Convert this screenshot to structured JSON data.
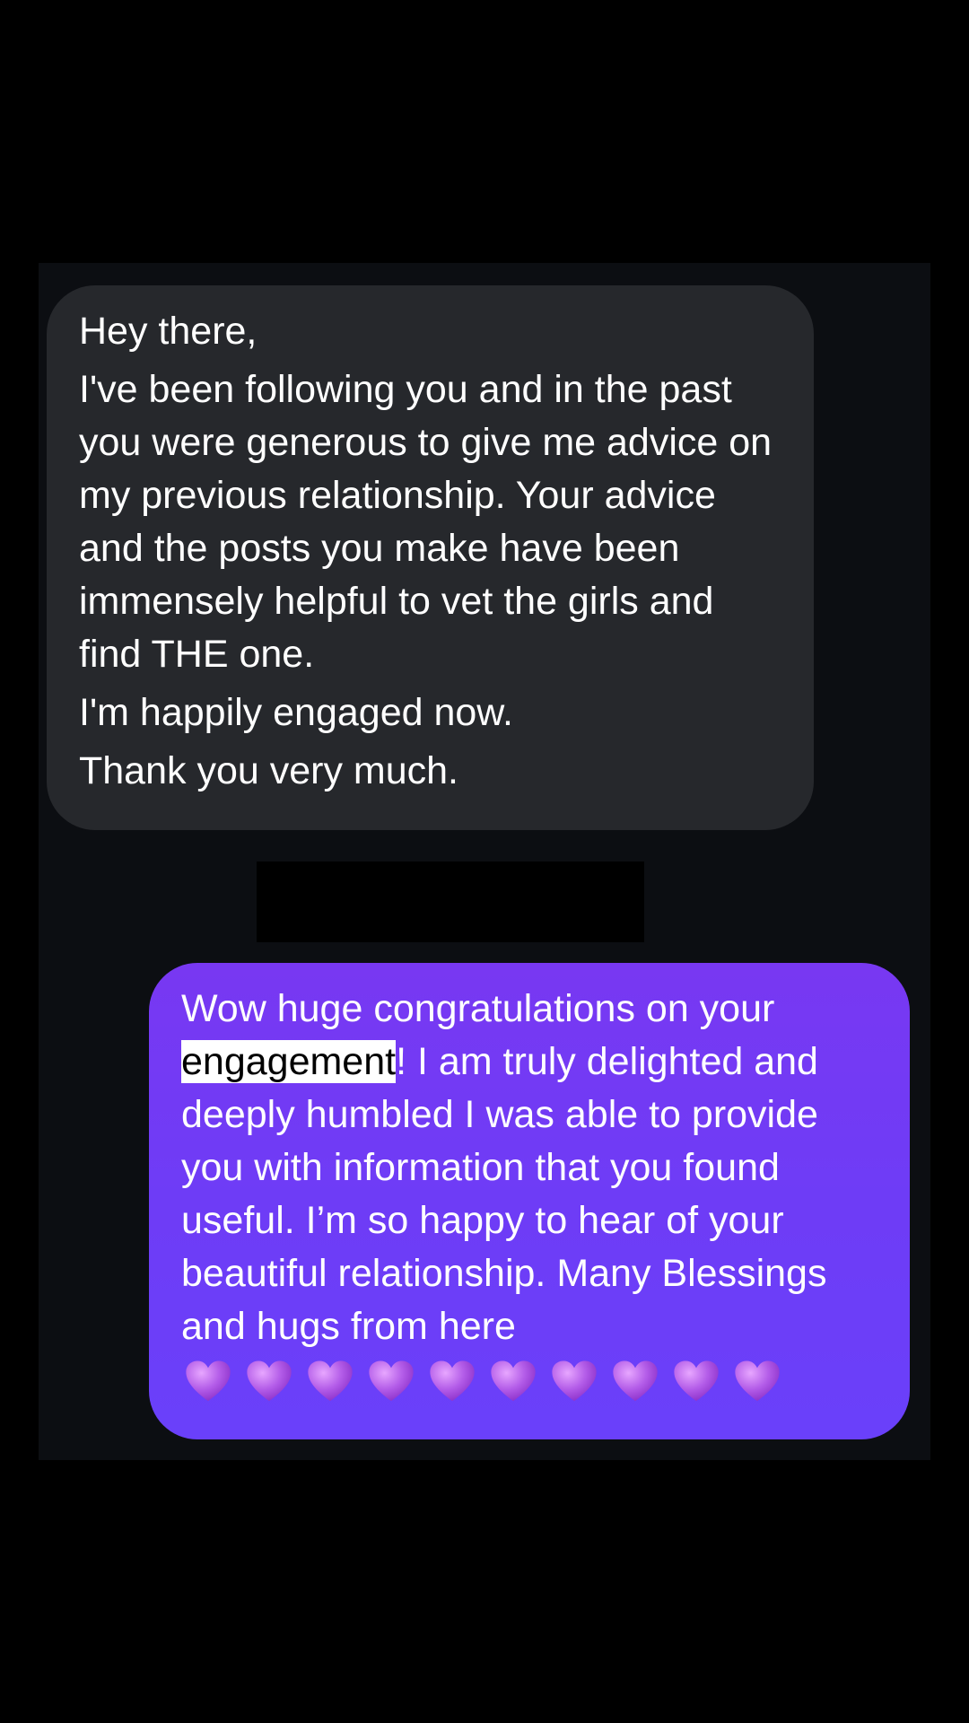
{
  "conversation": {
    "incoming_message": {
      "greeting": "Hey there,",
      "body": "I've been following you and in the past you were generous to give me advice on my previous relationship. Your advice and the posts you make have been immensely helpful to vet the girls and find THE one.",
      "line_engaged": "I'm happily engaged now.",
      "line_thanks": "Thank you very much."
    },
    "outgoing_message": {
      "text_before_highlight": "Wow huge congratulations on your ",
      "highlighted_word": "engagement",
      "text_after_highlight": "! I am truly delighted and deeply humbled I was able to provide you with information that you found useful. I’m so happy to hear of your beautiful relationship. Many Blessings and hugs from here",
      "heart_icon": "purple-heart-icon",
      "heart_count": 10
    }
  },
  "colors": {
    "background": "#000000",
    "chat_panel": "#0c0e12",
    "incoming_bubble": "#26282c",
    "outgoing_bubble_top": "#7838f2",
    "outgoing_bubble_bottom": "#6a40fa",
    "heart": "#b35ce8"
  }
}
